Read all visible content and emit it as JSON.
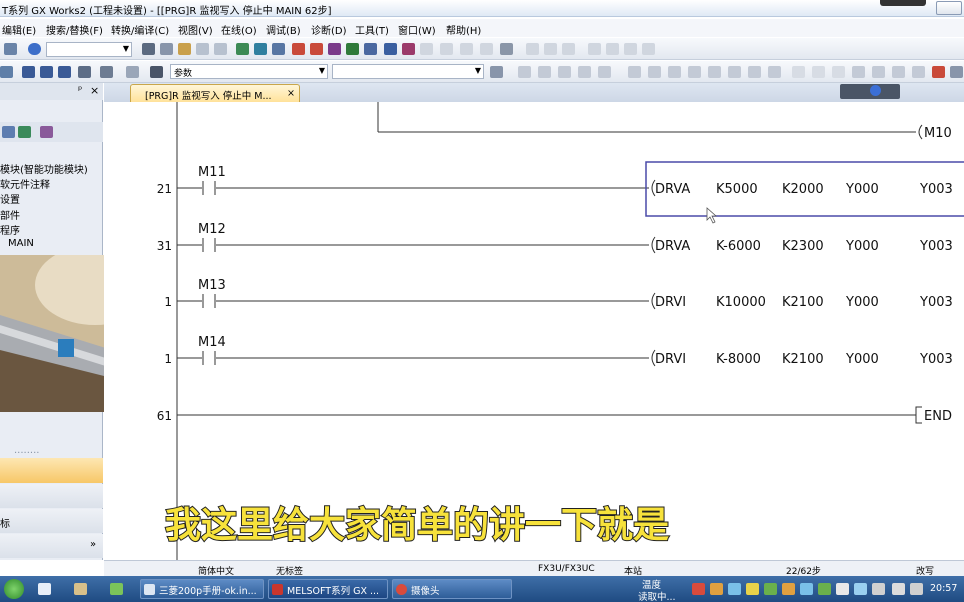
{
  "window": {
    "title": "T系列 GX Works2 (工程未设置) - [[PRG]R 监视写入 停止中 MAIN 62步]"
  },
  "menu": [
    "编辑(E)",
    "搜索/替换(F)",
    "转换/编译(C)",
    "视图(V)",
    "在线(O)",
    "调试(B)",
    "诊断(D)",
    "工具(T)",
    "窗口(W)",
    "帮助(H)"
  ],
  "toolbar": {
    "combo_param": "参数"
  },
  "nav_panel": {
    "pin": "ᵖ",
    "close": "×",
    "tree_items": [
      "模块(智能功能模块)",
      "软元件注释",
      "设置",
      "部件",
      "程序",
      "MAIN"
    ],
    "bottom_items": [
      "",
      "标"
    ],
    "dots": "........"
  },
  "document_tab": {
    "label": "[PRG]R 监视写入 停止中 M...",
    "close": "×"
  },
  "ladder": {
    "top_coil": "M10",
    "rungs": [
      {
        "step": "21",
        "contact": "M11",
        "instr": "DRVA",
        "op1": "K5000",
        "op2": "K2000",
        "op3": "Y000",
        "op4": "Y003",
        "selected": true
      },
      {
        "step": "31",
        "contact": "M12",
        "instr": "DRVA",
        "op1": "K-6000",
        "op2": "K2300",
        "op3": "Y000",
        "op4": "Y003",
        "selected": false
      },
      {
        "step": "1",
        "contact": "M13",
        "instr": "DRVI",
        "op1": "K10000",
        "op2": "K2100",
        "op3": "Y000",
        "op4": "Y003",
        "selected": false
      },
      {
        "step": "1",
        "contact": "M14",
        "instr": "DRVI",
        "op1": "K-8000",
        "op2": "K2100",
        "op3": "Y000",
        "op4": "Y003",
        "selected": false
      }
    ],
    "end_step": "61",
    "end_label": "END"
  },
  "statusbar": {
    "lang": "简体中文",
    "label": "无标签",
    "plc": "FX3U/FX3UC",
    "station": "本站",
    "steps": "22/62步",
    "mode": "改写"
  },
  "subtitle": "我这里给大家简单的讲一下就是",
  "taskbar": {
    "buttons": [
      "三菱200p手册-ok.in...",
      "MELSOFT系列 GX ...",
      "摄像头"
    ],
    "tray_temp": "温度",
    "tray_temp_sub": "读取中...",
    "clock": "20:57"
  },
  "colors": {
    "selection": "#4a4aa8",
    "subtitle": "#f7e23b",
    "taskbar": "#2b5a93"
  }
}
